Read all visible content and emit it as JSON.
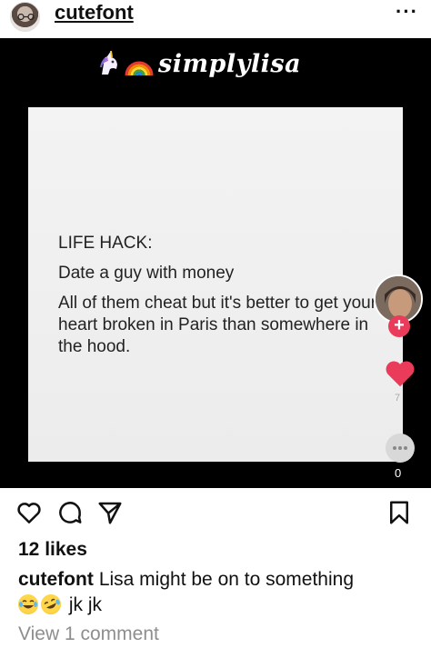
{
  "header": {
    "username": "cutefont",
    "more_glyph": "···"
  },
  "media": {
    "brand_text": "simplylisa",
    "brand_icons": [
      "unicorn-icon",
      "rainbow-icon"
    ],
    "card_lines": [
      "LIFE HACK:",
      "Date a guy with money",
      "All of them cheat but it's better to get your heart broken in Paris than somewhere in the hood."
    ],
    "side_heart_count": "7",
    "side_dots_count": "0",
    "plus_glyph": "+"
  },
  "actions": {
    "icons": [
      "heart-outline-icon",
      "comment-icon",
      "share-icon",
      "bookmark-icon"
    ]
  },
  "likes": "12 likes",
  "caption": {
    "username": "cutefont",
    "text": "Lisa might be on to something",
    "second_line": "jk jk",
    "emojis": [
      "joy-emoji",
      "rofl-emoji"
    ]
  },
  "view_comments": "View 1 comment",
  "colors": {
    "accent_red": "#ea3b5b",
    "muted_gray": "#8e8e8e",
    "media_bg": "#000000"
  }
}
